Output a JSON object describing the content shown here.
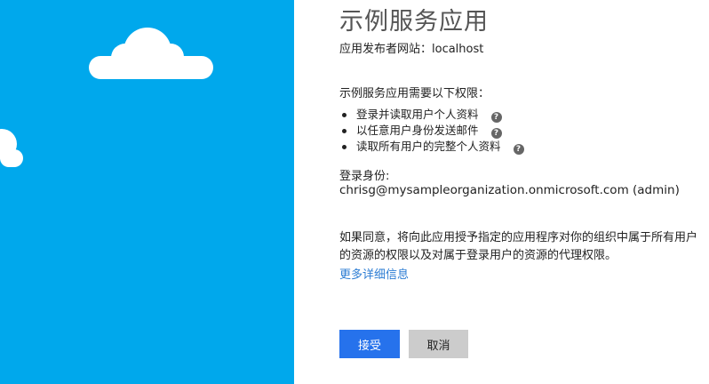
{
  "app": {
    "title": "示例服务应用",
    "publisher_label": "应用发布者网站：localhost"
  },
  "permissions": {
    "intro": "示例服务应用需要以下权限：",
    "items": [
      {
        "label": "登录并读取用户个人资料",
        "icon": "help-icon"
      },
      {
        "label": "以任意用户身份发送邮件",
        "icon": "help-icon"
      },
      {
        "label": "读取所有用户的完整个人资料",
        "icon": "help-icon"
      }
    ],
    "help_glyph": "?"
  },
  "signed_in": {
    "label": "登录身份:",
    "user": "chrisg@mysampleorganization.onmicrosoft.com (admin)"
  },
  "consent": {
    "text": "如果同意，将向此应用授予指定的应用程序对你的组织中属于所有用户的资源的权限以及对属于登录用户的资源的代理权限。",
    "more_link": "更多详细信息"
  },
  "buttons": {
    "accept": "接受",
    "cancel": "取消"
  },
  "colors": {
    "left_panel": "#00a8ec",
    "accept_button": "#2672ec",
    "cancel_button": "#cccccc",
    "link": "#2b7cd3"
  }
}
